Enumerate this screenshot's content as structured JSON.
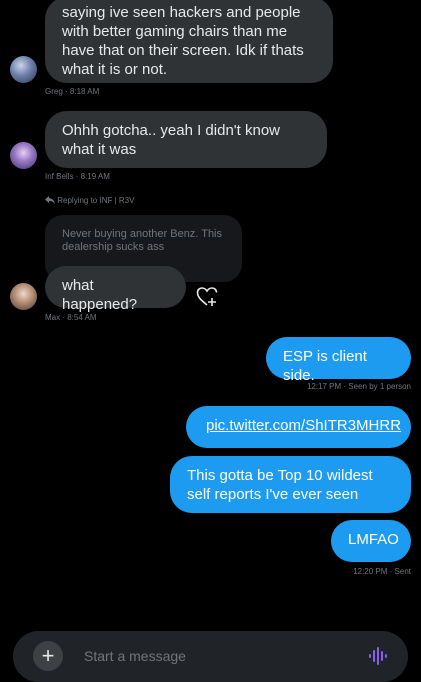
{
  "messages": {
    "greg_msg": "saying ive seen hackers and people with better gaming chairs than me have that on their screen. Idk if thats what it is or not.",
    "greg_meta": "Greg · 8:18 AM",
    "inf_msg": "Ohhh gotcha.. yeah I didn't know what it was",
    "inf_meta": "Inf Bells · 8:19 AM",
    "reply_label": "Replying to INF | R3V",
    "quoted_msg": "Never buying another Benz. This dealership sucks ass",
    "max_msg": "what happened?",
    "max_meta": "Max · 8:54 AM",
    "out1": "ESP is client side.",
    "out1_meta": "12:17 PM · Seen by 1 person",
    "out2": "pic.twitter.com/ShITR3MHRR",
    "out3": "This gotta be Top 10 wildest self reports I've ever seen",
    "out4": "LMFAO",
    "out4_meta": "12:20 PM · Sent"
  },
  "composer": {
    "placeholder": "Start a message",
    "plus": "+"
  },
  "icons": {
    "react": "heart-plus-icon",
    "reply_arrow": "reply-arrow-icon",
    "voice": "waveform-icon"
  },
  "colors": {
    "accent": "#1d9bf0",
    "bubble_in": "#2f3336",
    "voice": "#8b5cf6"
  }
}
